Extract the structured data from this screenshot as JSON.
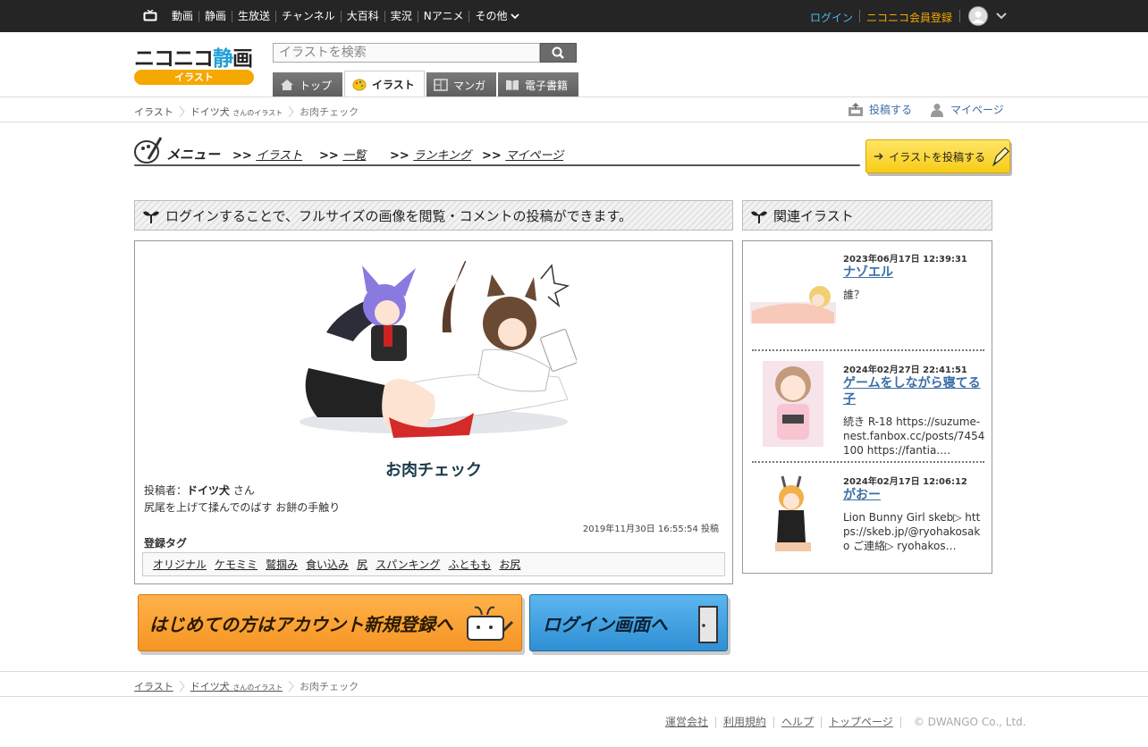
{
  "topbar": {
    "links": [
      "動画",
      "静画",
      "生放送",
      "チャンネル",
      "大百科",
      "実況",
      "Nアニメ"
    ],
    "more_label": "その他",
    "login_label": "ログイン",
    "register_label": "ニコニコ会員登録",
    "colors": {
      "background": "#252525",
      "login": "#4fb8e8",
      "register": "#f5a800"
    }
  },
  "logo": {
    "main": "ニコニコ",
    "accent": "静",
    "tail": "画",
    "sub": "イラスト"
  },
  "search": {
    "placeholder": "イラストを検索"
  },
  "tabs": [
    {
      "label": "トップ",
      "icon": "home-icon",
      "active": false
    },
    {
      "label": "イラスト",
      "icon": "palette-icon",
      "active": true
    },
    {
      "label": "マンガ",
      "icon": "manga-icon",
      "active": false
    },
    {
      "label": "電子書籍",
      "icon": "book-icon",
      "active": false
    }
  ],
  "breadcrumb": {
    "root": "イラスト",
    "user": "ドイツ犬",
    "user_suffix": "さんのイラスト",
    "current": "お肉チェック"
  },
  "header_actions": {
    "post_label": "投稿する",
    "mypage_label": "マイページ"
  },
  "menu": {
    "title": "メニュー",
    "prefix": ">>",
    "items": [
      "イラスト",
      "一覧",
      "ランキング",
      "マイページ"
    ],
    "upload_label": "イラストを投稿する"
  },
  "main": {
    "notice": "ログインすることで、フルサイズの画像を閲覧・コメントの投稿ができます。",
    "title": "お肉チェック",
    "poster_label": "投稿者：",
    "poster_name": "ドイツ犬",
    "poster_suffix": " さん",
    "description": "尻尾を上げて揉んでのばす お餅の手触り",
    "date": "2019年11月30日 16:55:54 投稿",
    "tags_label": "登録タグ",
    "tags": [
      "オリジナル",
      "ケモミミ",
      "鷲掴み",
      "食い込み",
      "尻",
      "スパンキング",
      "ふともも",
      "お尻"
    ]
  },
  "banners": {
    "register": "はじめての方はアカウント新規登録へ",
    "login": "ログイン画面へ"
  },
  "related": {
    "title": "関連イラスト",
    "items": [
      {
        "date": "2023年06月17日 12:39:31",
        "title": "ナゾエル",
        "desc": "誰？"
      },
      {
        "date": "2024年02月27日 22:41:51",
        "title": "ゲームをしながら寝てる子",
        "desc": "続き R-18 https://suzume-nest.fanbox.cc/posts/7454100 https://fantia.…"
      },
      {
        "date": "2024年02月17日 12:06:12",
        "title": "がおー",
        "desc": "Lion Bunny Girl skeb▷ https://skeb.jp/@ryohakosako ご連絡▷ ryohakos…"
      }
    ]
  },
  "footer": {
    "links": [
      "運営会社",
      "利用規約",
      "ヘルプ",
      "トップページ"
    ],
    "copyright": "© DWANGO Co., Ltd."
  }
}
